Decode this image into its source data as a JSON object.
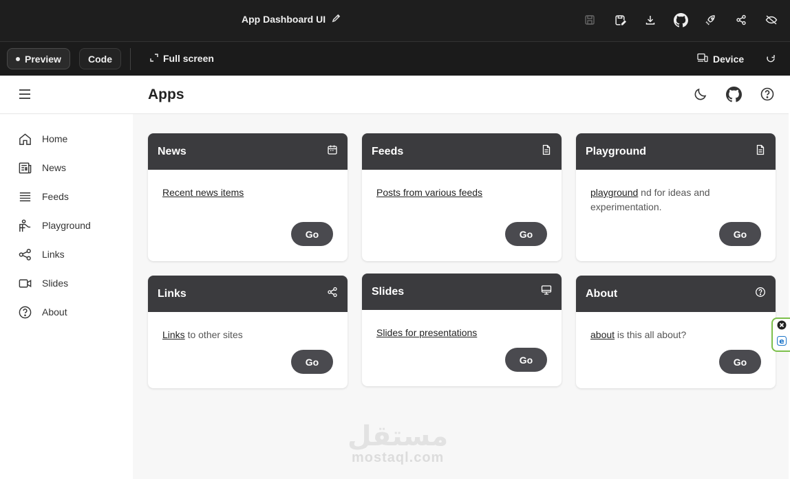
{
  "topbar": {
    "title": "App Dashboard UI",
    "actions": [
      "save-icon",
      "save-as-icon",
      "download-icon",
      "github-icon",
      "rocket-icon",
      "share-icon",
      "hide-icon"
    ]
  },
  "toolbar": {
    "preview_label": "Preview",
    "code_label": "Code",
    "fullscreen_label": "Full screen",
    "device_label": "Device"
  },
  "header": {
    "title": "Apps"
  },
  "sidebar": {
    "items": [
      {
        "label": "Home",
        "icon": "home-icon"
      },
      {
        "label": "News",
        "icon": "newspaper-icon"
      },
      {
        "label": "Feeds",
        "icon": "list-icon"
      },
      {
        "label": "Playground",
        "icon": "playground-icon"
      },
      {
        "label": "Links",
        "icon": "share-icon"
      },
      {
        "label": "Slides",
        "icon": "video-icon"
      },
      {
        "label": "About",
        "icon": "help-icon"
      }
    ]
  },
  "cards": [
    {
      "title": "News",
      "icon": "calendar-icon",
      "link": "Recent news items",
      "rest": "",
      "button": "Go"
    },
    {
      "title": "Feeds",
      "icon": "document-icon",
      "link": "Posts from various feeds",
      "rest": "",
      "button": "Go"
    },
    {
      "title": "Playground",
      "icon": "document-icon",
      "link": "playground",
      "rest": " nd for ideas and experimentation.",
      "button": "Go"
    },
    {
      "title": "Links",
      "icon": "share-icon",
      "link": "Links",
      "rest": " to other sites",
      "button": "Go"
    },
    {
      "title": "Slides",
      "icon": "monitor-icon",
      "link": "Slides for presentations",
      "rest": "",
      "button": "Go"
    },
    {
      "title": "About",
      "icon": "help-icon",
      "link": "about",
      "rest": " is this all about?",
      "button": "Go"
    }
  ],
  "watermark": {
    "arabic": "مستقل",
    "latin": "mostaql.com"
  }
}
